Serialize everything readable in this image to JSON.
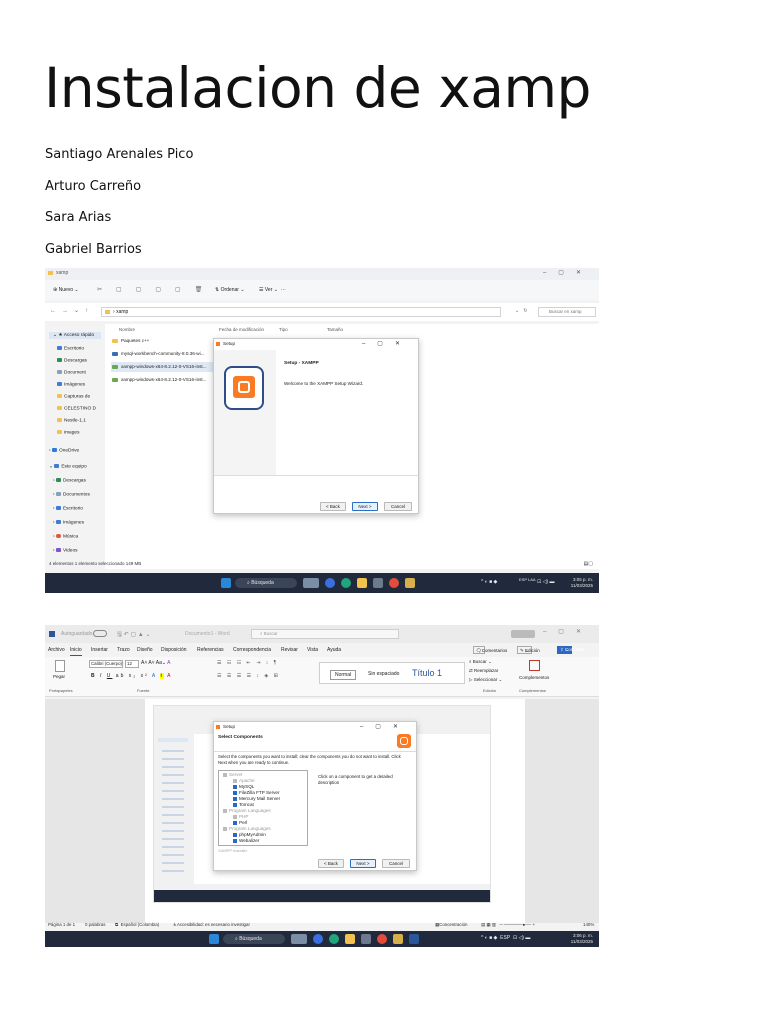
{
  "document": {
    "title": "Instalacion de xamp",
    "authors": [
      "Santiago Arenales Pico",
      "Arturo Carreño",
      "Sara Arias",
      "Gabriel Barrios"
    ]
  },
  "screenshot1": {
    "window_title": "xamp",
    "toolbar": {
      "new": "Nuevo",
      "sort": "Ordenar",
      "view": "Ver"
    },
    "address": "xamp",
    "search_placeholder": "Buscar en xamp",
    "nav": {
      "quick_access": "Acceso rápido",
      "items": [
        "Escritorio",
        "Descargas",
        "Document",
        "Imágenes",
        "Capturas de",
        "CELESTINO D",
        "Nestle-1.1",
        "images"
      ],
      "onedrive": "OneDrive",
      "this_pc": "Este equipo",
      "pc_items": [
        "Descargas",
        "Documentos",
        "Escritorio",
        "Imágenes",
        "Música",
        "Videos"
      ]
    },
    "columns": {
      "name": "Nombre",
      "modified": "Fecha de modificación",
      "type": "Tipo",
      "size": "Tamaño"
    },
    "files": [
      "Paquetes c++",
      "mysql-workbench-community-8.0.36-wi...",
      "xampp-windows-x64-8.2.12-0-VS16-inst...",
      "xampp-windows-x64-8.2.12-0-VS16-inst..."
    ],
    "status": "4 elementos    1 elemento seleccionado  149 MB",
    "dialog": {
      "title": "Setup",
      "heading": "Setup - XAMPP",
      "welcome": "Welcome to the XAMPP Setup Wizard.",
      "back": "< Back",
      "next": "Next >",
      "cancel": "Cancel"
    },
    "taskbar": {
      "search": "Búsqueda",
      "lang": "ESP\nLAA",
      "time": "3:05 p. m.",
      "date": "11/03/2025"
    }
  },
  "screenshot2": {
    "title_bar": {
      "autosave": "Autoguardado",
      "doc_name": "Documento1 - Word",
      "search": "Buscar"
    },
    "menu": [
      "Archivo",
      "Inicio",
      "Insertar",
      "Trazo",
      "Diseño",
      "Disposición",
      "Referencias",
      "Correspondencia",
      "Revisar",
      "Vista",
      "Ayuda"
    ],
    "comments": "Comentarios",
    "editing": "Edición",
    "share": "Compartir",
    "font_name": "Calibri (Cuerpo)",
    "font_size": "12",
    "paste": "Pegar",
    "styles": {
      "normal": "Normal",
      "no_spacing": "Sin espaciado",
      "title1": "Título 1"
    },
    "editing_group": {
      "find": "Buscar",
      "replace": "Reemplazar",
      "select": "Seleccionar"
    },
    "addins": "Complementos",
    "group_labels": {
      "clipboard": "Portapapeles",
      "font": "Fuente",
      "editing": "Edición",
      "addins": "Complementos"
    },
    "dialog": {
      "title": "Setup",
      "heading": "Select Components",
      "instructions": "Select the components you want to install; clear the components you do not want to install. Click Next when you are ready to continue.",
      "hint": "Click on a component to get a detailed description",
      "components": [
        "Server",
        "Apache",
        "MySQL",
        "FileZilla FTP Server",
        "Mercury Mail Server",
        "Tomcat",
        "Program Languages",
        "PHP",
        "Perl",
        "Program Languages",
        "phpMyAdmin",
        "Webalizer"
      ],
      "footer": "XAMPP Installer",
      "back": "< Back",
      "next": "Next >",
      "cancel": "Cancel"
    },
    "status": {
      "page": "Página 1 de 1",
      "words": "0 palabras",
      "lang": "Español (Colombia)",
      "accessibility": "Accesibilidad: es necesario investigar",
      "focus": "Concentración",
      "zoom": "140%"
    },
    "taskbar": {
      "search": "Búsqueda",
      "time": "3:06 p. m.",
      "date": "11/03/2025"
    }
  }
}
